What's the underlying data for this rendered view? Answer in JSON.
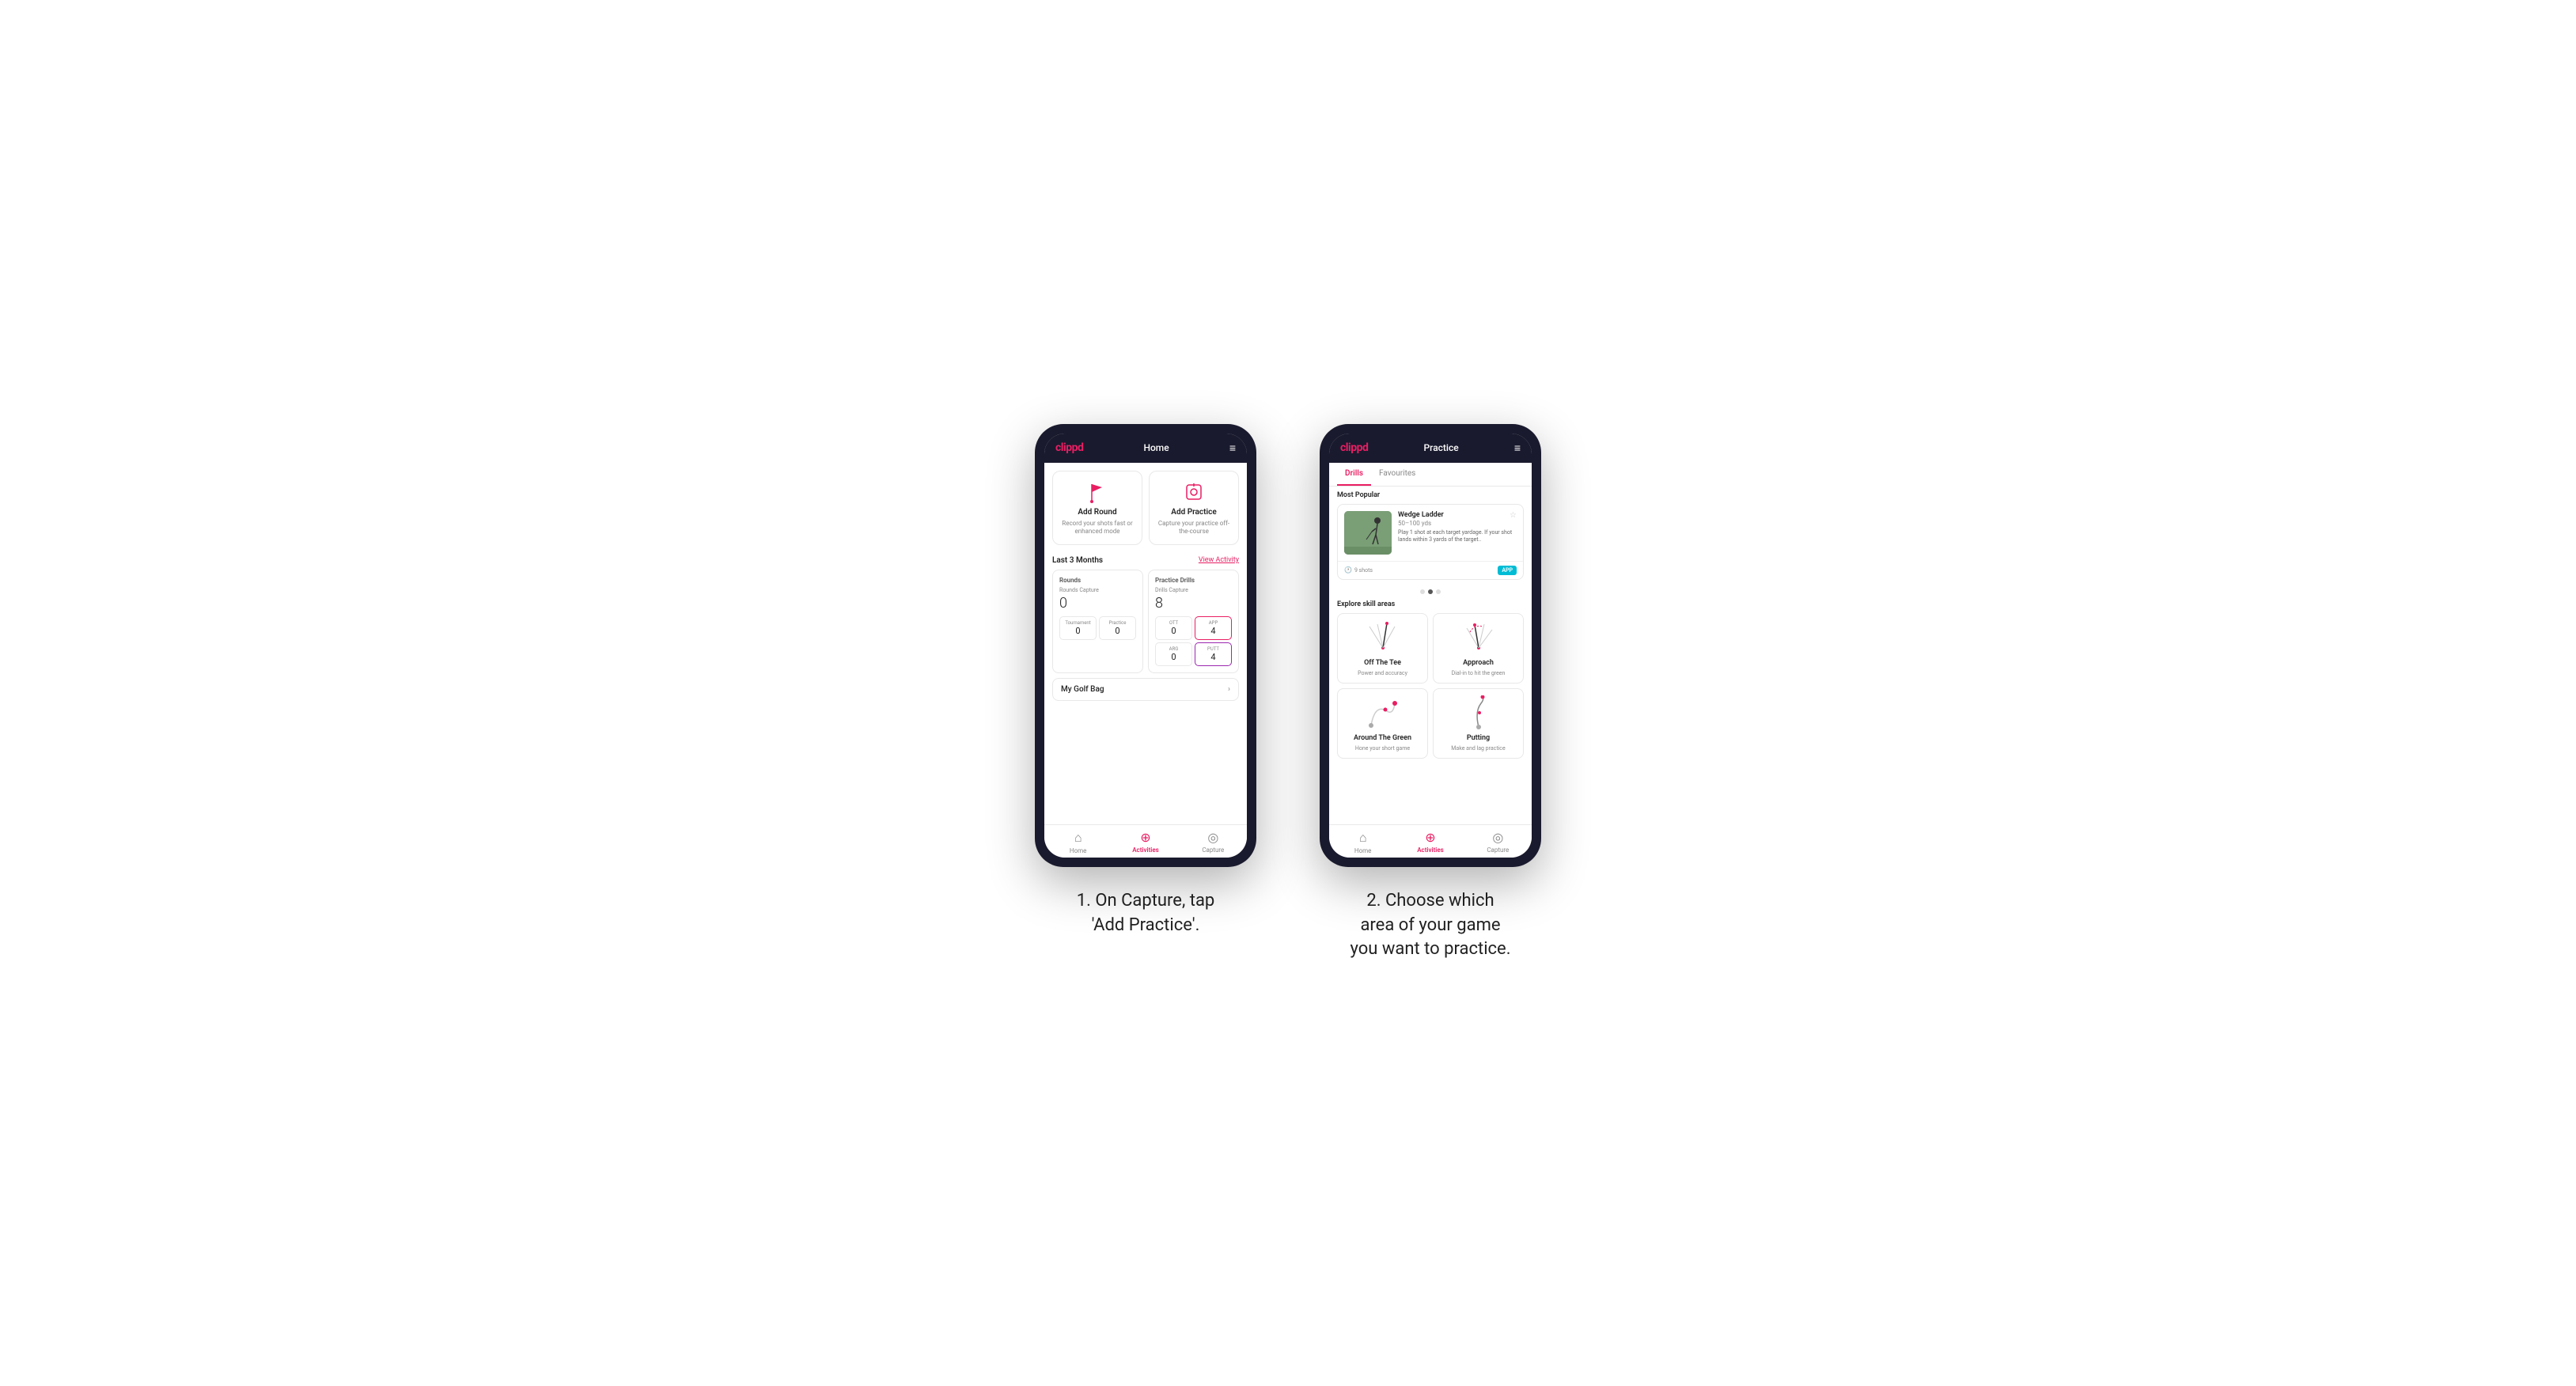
{
  "page": {
    "background": "#ffffff"
  },
  "phone1": {
    "header": {
      "logo": "clippd",
      "title": "Home",
      "menu_icon": "≡"
    },
    "action_cards": [
      {
        "title": "Add Round",
        "subtitle": "Record your shots fast or enhanced mode",
        "icon_type": "flag"
      },
      {
        "title": "Add Practice",
        "subtitle": "Capture your practice off-the-course",
        "icon_type": "practice"
      }
    ],
    "stats_section": {
      "label": "Last 3 Months",
      "view_link": "View Activity"
    },
    "rounds": {
      "header": "Rounds",
      "rounds_capture_label": "Rounds Capture",
      "rounds_capture_value": "0",
      "tournament_label": "Tournament",
      "tournament_value": "0",
      "practice_label": "Practice",
      "practice_value": "0"
    },
    "practice_drills": {
      "header": "Practice Drills",
      "drills_capture_label": "Drills Capture",
      "drills_capture_value": "8",
      "ott_label": "OTT",
      "ott_value": "0",
      "app_label": "APP",
      "app_value": "4",
      "arg_label": "ARG",
      "arg_value": "0",
      "putt_label": "PUTT",
      "putt_value": "4"
    },
    "golf_bag": {
      "label": "My Golf Bag"
    },
    "nav": [
      {
        "icon": "⌂",
        "label": "Home",
        "active": false
      },
      {
        "icon": "◎",
        "label": "Activities",
        "active": true
      },
      {
        "icon": "⊕",
        "label": "Capture",
        "active": false
      }
    ]
  },
  "phone2": {
    "header": {
      "logo": "clippd",
      "title": "Practice",
      "menu_icon": "≡"
    },
    "tabs": [
      {
        "label": "Drills",
        "active": true
      },
      {
        "label": "Favourites",
        "active": false
      }
    ],
    "most_popular_label": "Most Popular",
    "featured_drill": {
      "title": "Wedge Ladder",
      "yardage": "50–100 yds",
      "description": "Play 1 shot at each target yardage. If your shot lands within 3 yards of the target..",
      "shots_label": "9 shots",
      "badge": "APP"
    },
    "dots": [
      false,
      true,
      false
    ],
    "explore_label": "Explore skill areas",
    "skill_areas": [
      {
        "title": "Off The Tee",
        "subtitle": "Power and accuracy",
        "icon": "tee"
      },
      {
        "title": "Approach",
        "subtitle": "Dial-in to hit the green",
        "icon": "approach"
      },
      {
        "title": "Around The Green",
        "subtitle": "Hone your short game",
        "icon": "atg"
      },
      {
        "title": "Putting",
        "subtitle": "Make and lag practice",
        "icon": "putting"
      }
    ],
    "nav": [
      {
        "icon": "⌂",
        "label": "Home",
        "active": false
      },
      {
        "icon": "◎",
        "label": "Activities",
        "active": true
      },
      {
        "icon": "⊕",
        "label": "Capture",
        "active": false
      }
    ]
  },
  "captions": {
    "caption1": "1. On Capture, tap\n'Add Practice'.",
    "caption2": "2. Choose which\narea of your game\nyou want to practice."
  }
}
